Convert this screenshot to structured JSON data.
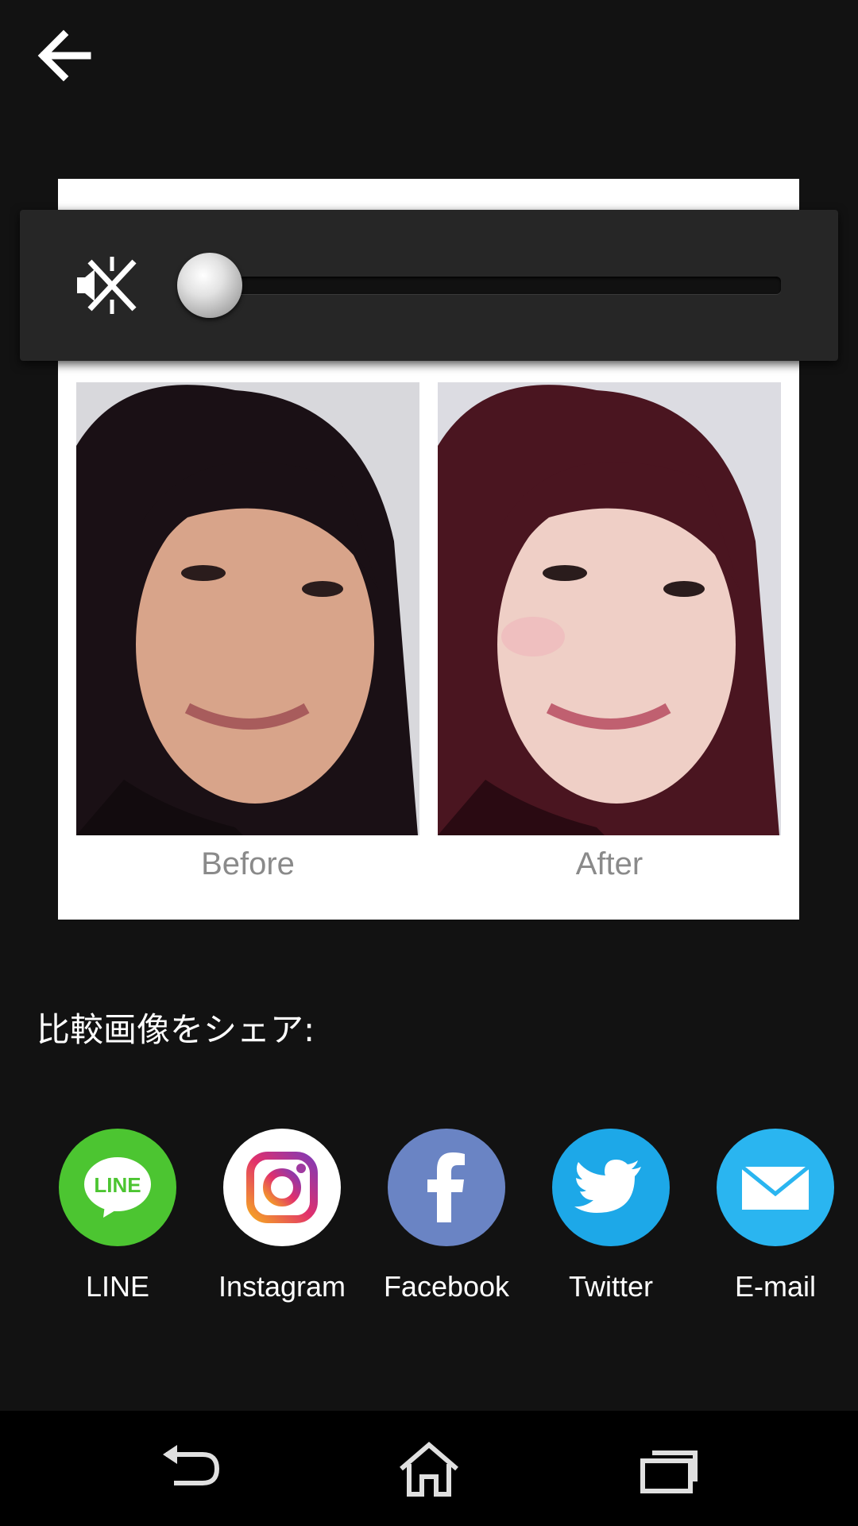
{
  "topbar": {
    "back_icon": "arrow-left-icon"
  },
  "volume_panel": {
    "mute_icon": "speaker-muted-icon",
    "slider_value": 0
  },
  "comparison": {
    "before_label": "Before",
    "after_label": "After"
  },
  "share": {
    "title": "比較画像をシェア:",
    "items": [
      {
        "label": "LINE",
        "icon": "line-icon",
        "color": "#4cc531"
      },
      {
        "label": "Instagram",
        "icon": "instagram-icon",
        "color": "#ffffff"
      },
      {
        "label": "Facebook",
        "icon": "facebook-icon",
        "color": "#6a84c4"
      },
      {
        "label": "Twitter",
        "icon": "twitter-icon",
        "color": "#1da8e8"
      },
      {
        "label": "E-mail",
        "icon": "mail-icon",
        "color": "#2ab5f0"
      }
    ]
  },
  "navbar": {
    "back_icon": "nav-back-icon",
    "home_icon": "nav-home-icon",
    "recents_icon": "nav-recents-icon"
  },
  "colors": {
    "background": "#121212",
    "panel": "#262626",
    "navbar": "#000000"
  }
}
